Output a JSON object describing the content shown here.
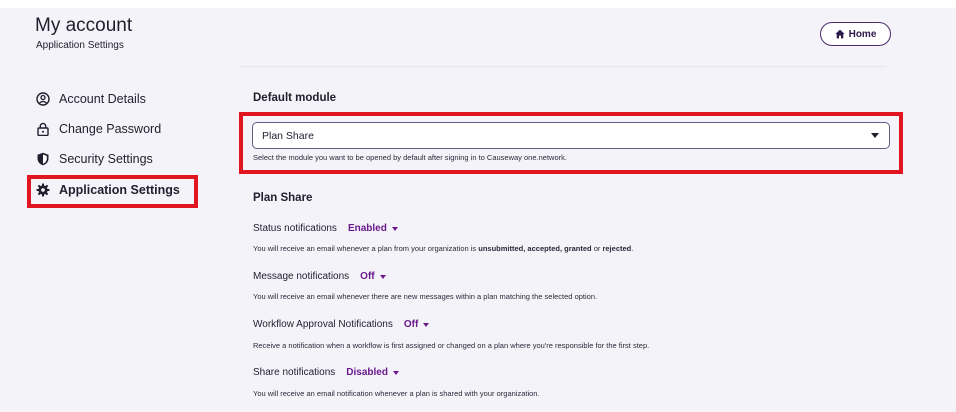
{
  "header": {
    "title": "My account",
    "subtitle": "Application Settings",
    "home_label": "Home"
  },
  "sidebar": {
    "items": [
      {
        "label": "Account Details",
        "icon": "account-circle-icon"
      },
      {
        "label": "Change Password",
        "icon": "lock-icon"
      },
      {
        "label": "Security Settings",
        "icon": "shield-icon"
      },
      {
        "label": "Application Settings",
        "icon": "gear-icon",
        "active": true
      }
    ]
  },
  "default_module": {
    "title": "Default module",
    "selected": "Plan Share",
    "helper": "Select the module you want to be opened by default after signing in to Causeway one.network."
  },
  "plan_share": {
    "title": "Plan Share",
    "notifications": [
      {
        "label": "Status notifications",
        "value": "Enabled",
        "desc_pre": "You will receive an email whenever a plan from your organization is ",
        "desc_bold": "unsubmitted, accepted, granted",
        "desc_mid": " or ",
        "desc_bold2": "rejected",
        "desc_post": "."
      },
      {
        "label": "Message notifications",
        "value": "Off",
        "desc": "You will receive an email whenever there are new messages within a plan matching the selected option."
      },
      {
        "label": "Workflow Approval Notifications",
        "value": "Off",
        "desc": "Receive a notification when a workflow is first assigned or changed on a plan where you're responsible for the first step."
      },
      {
        "label": "Share notifications",
        "value": "Disabled",
        "desc": "You will receive an email notification whenever a plan is shared with your organization."
      }
    ]
  },
  "colors": {
    "accent": "#6b1a8c",
    "highlight": "#e0151f",
    "background": "#f4f3fa"
  }
}
